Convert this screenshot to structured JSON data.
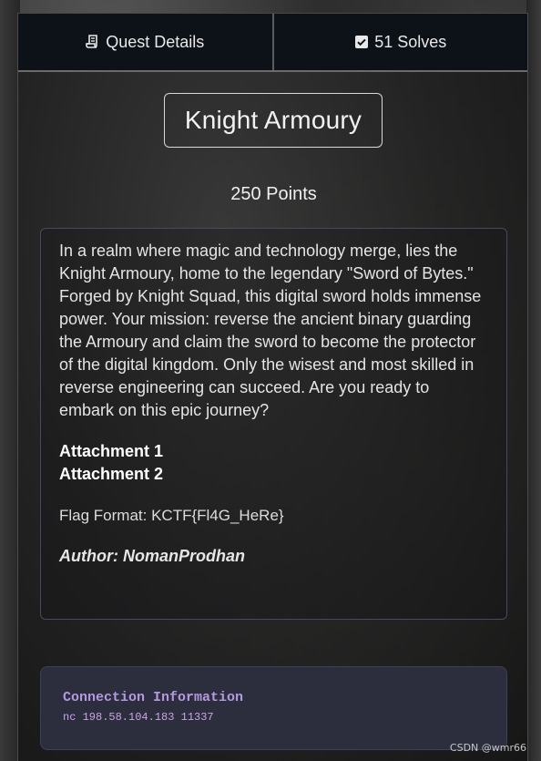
{
  "tabs": [
    {
      "label": "Quest Details",
      "icon": "scroll-icon"
    },
    {
      "label": "51 Solves",
      "icon": "checkbox-icon"
    }
  ],
  "challenge": {
    "title": "Knight Armoury",
    "points": "250 Points",
    "description": "In a realm where magic and technology merge, lies the Knight Armoury, home to the legendary \"Sword of Bytes.\" Forged by Knight Squad, this digital sword holds immense power. Your mission: reverse the ancient binary guarding the Armoury and claim the sword to become the protector of the digital kingdom. Only the wisest and most skilled in reverse engineering can succeed. Are you ready to embark on this epic journey?",
    "attachments": [
      "Attachment 1",
      "Attachment 2"
    ],
    "flag_format": "Flag Format: KCTF{Fl4G_HeRe}",
    "author": "Author: NomanProdhan"
  },
  "connection": {
    "title": "Connection Information",
    "command": "nc 198.58.104.183 11337"
  },
  "watermark": "CSDN @wmr66",
  "colors": {
    "tab_bg": "#0d1219",
    "connection_bg": "#2c2e3e",
    "connection_text": "#b59ae0"
  }
}
